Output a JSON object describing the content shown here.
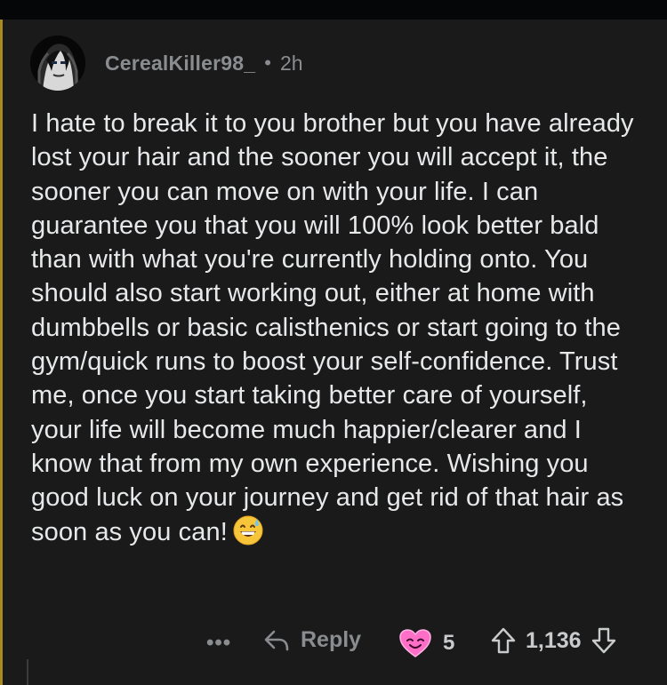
{
  "comment": {
    "username": "CerealKiller98_",
    "separator": "•",
    "time": "2h",
    "body": "I hate to break it to you brother but you have already lost your hair and the sooner you will accept it, the sooner you can move on with your life. I can guarantee you that you will 100% look better bald than with what you're currently holding onto. You should also start working out, either at home with dumbbells or basic calisthenics or start going to the gym/quick runs to boost your self-confidence. Trust me, once you start taking better care of yourself, your life will become much happier/clearer and I know that from my own experience. Wishing you good luck on your journey and get rid of that hair as soon as you can!",
    "emoji": "grinning-sweat-emoji"
  },
  "actions": {
    "more_label": "•••",
    "reply_label": "Reply",
    "award_count": "5",
    "score": "1,136"
  },
  "colors": {
    "background": "#1a1a1b",
    "thread_line": "#a98a1e",
    "muted_text": "#8a8d90",
    "body_text": "#e6e8ea"
  }
}
